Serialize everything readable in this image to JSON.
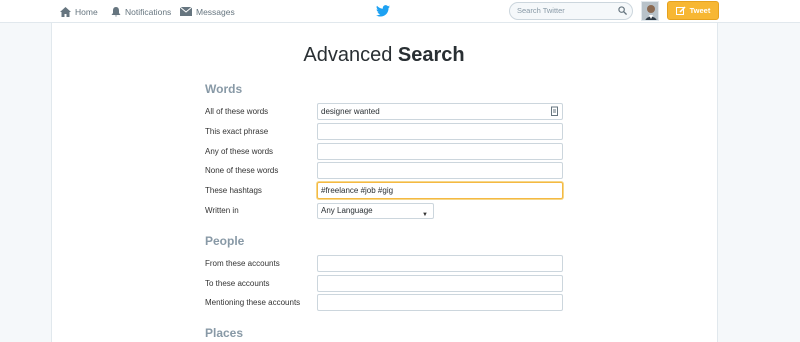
{
  "nav": {
    "home": "Home",
    "notifications": "Notifications",
    "messages": "Messages"
  },
  "search": {
    "placeholder": "Search Twitter"
  },
  "tweet_button": {
    "label": "Tweet"
  },
  "page": {
    "title_light": "Advanced",
    "title_bold": "Search"
  },
  "words": {
    "heading": "Words",
    "all_label": "All of these words",
    "all_value": "designer wanted",
    "exact_label": "This exact phrase",
    "exact_value": "",
    "any_label": "Any of these words",
    "any_value": "",
    "none_label": "None of these words",
    "none_value": "",
    "hashtags_label": "These hashtags",
    "hashtags_value": "#freelance #job #gig",
    "lang_label": "Written in",
    "lang_value": "Any Language"
  },
  "people": {
    "heading": "People",
    "from_label": "From these accounts",
    "from_value": "",
    "to_label": "To these accounts",
    "to_value": "",
    "mention_label": "Mentioning these accounts",
    "mention_value": ""
  },
  "places": {
    "heading": "Places"
  },
  "colors": {
    "brand": "#1da1f2",
    "tweet_button": "#f7b733",
    "focus": "#f5b942"
  },
  "icons": {
    "home": "home-icon",
    "notifications": "bell-icon",
    "messages": "envelope-icon",
    "logo": "twitter-bird-icon",
    "search": "search-icon",
    "compose": "compose-icon"
  }
}
